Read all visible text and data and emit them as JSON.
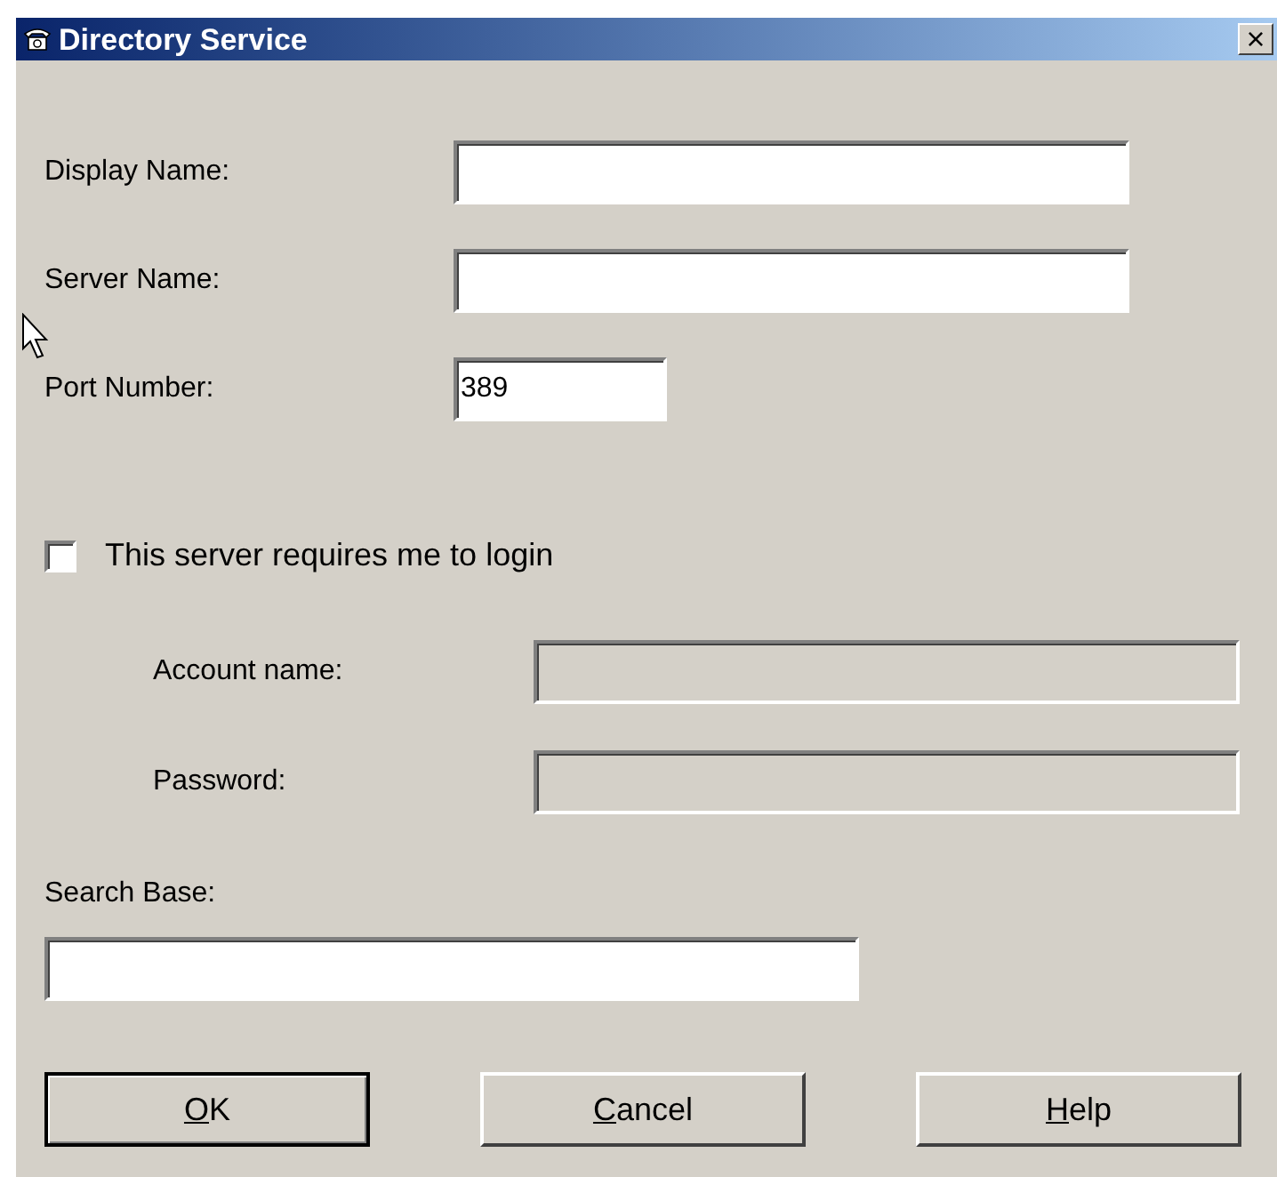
{
  "window": {
    "title": "Directory Service",
    "close": "×"
  },
  "fields": [
    {
      "label": "Display Name:"
    },
    {
      "label": "Server Name:"
    },
    {
      "label": "Port Number:",
      "value": "389"
    }
  ],
  "login_checkbox": {
    "label": "This server requires me to login",
    "checked": false
  },
  "login_fields": [
    {
      "label": "Account name:",
      "disabled": true
    },
    {
      "label": "Password:",
      "disabled": true
    }
  ],
  "search_base": {
    "label": "Search Base:"
  },
  "buttons": [
    {
      "accel": "O",
      "rest": "K",
      "default": true
    },
    {
      "accel": "C",
      "rest": "ancel",
      "default": false
    },
    {
      "accel": "H",
      "rest": "elp",
      "default": false
    }
  ]
}
